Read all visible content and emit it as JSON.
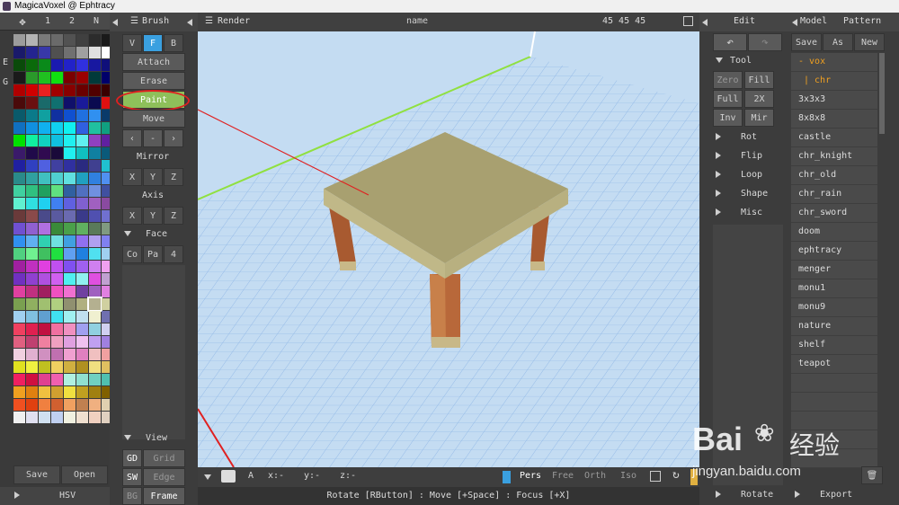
{
  "window": {
    "title": "MagicaVoxel @ Ephtracy"
  },
  "palette_bar": {
    "tabs": [
      "1",
      "2",
      "N"
    ]
  },
  "side_letters": [
    "E",
    "G"
  ],
  "palette_colors": [
    "#9c9c9c",
    "#b4b4b4",
    "#7a7a7a",
    "#6a6a6a",
    "#525252",
    "#404040",
    "#2c2c2c",
    "#1a1a1a",
    "#1a1a6a",
    "#242490",
    "#3838a8",
    "#505050",
    "#707070",
    "#a0a0a0",
    "#e0e0e0",
    "#ffffff",
    "#0a4a0a",
    "#0a6a0a",
    "#0a8a1a",
    "#1a1ab0",
    "#2222c8",
    "#3030e0",
    "#1818a0",
    "#10107a",
    "#1a1a1a",
    "#2a9a2a",
    "#20c020",
    "#10e010",
    "#7a0000",
    "#9a0000",
    "#003a3a",
    "#00006a",
    "#b00000",
    "#d00000",
    "#e82020",
    "#a00000",
    "#880000",
    "#6a0000",
    "#500000",
    "#3a0000",
    "#4a0a0a",
    "#6a1010",
    "#1a6a6a",
    "#107070",
    "#10106a",
    "#1a1a9a",
    "#0a0a50",
    "#e01010",
    "#0a5a6a",
    "#0a7a8a",
    "#10a0a0",
    "#1030a0",
    "#1050d0",
    "#2070e0",
    "#3090f0",
    "#0a3a6a",
    "#1070c0",
    "#1090e0",
    "#10b0f0",
    "#10d0f0",
    "#10f0f0",
    "#3060e0",
    "#20c0a0",
    "#10a080",
    "#00e000",
    "#10f0a0",
    "#10d0c0",
    "#10c0e0",
    "#20f0f0",
    "#60f0f0",
    "#9040c0",
    "#6020a0",
    "#3a1a6a",
    "#200a4a",
    "#300a50",
    "#1a0a3a",
    "#20f0f0",
    "#10c0c0",
    "#1080a0",
    "#0a5a7a",
    "#2020a0",
    "#3040c0",
    "#5060e0",
    "#4040a0",
    "#3030a0",
    "#2a2a80",
    "#404090",
    "#20c0d0",
    "#2a8a8a",
    "#30a0a0",
    "#40c0c0",
    "#50d0d0",
    "#60e0e0",
    "#20a0c0",
    "#3080e0",
    "#5090f0",
    "#40d0a0",
    "#30c080",
    "#20a060",
    "#60e080",
    "#3060a0",
    "#5070c0",
    "#7090e0",
    "#4050a0",
    "#60f0d0",
    "#30e0e0",
    "#20d0f0",
    "#4080f0",
    "#6060e0",
    "#8060d0",
    "#a060c0",
    "#8a4aa0",
    "#6a3a3a",
    "#8a4a4a",
    "#4a4a8a",
    "#5a5aa0",
    "#6a6ab0",
    "#3a3a8a",
    "#5050b0",
    "#7070d0",
    "#7050d0",
    "#9060d0",
    "#b070e0",
    "#3a8a3a",
    "#4aa04a",
    "#60b060",
    "#5a7a5a",
    "#809a80",
    "#3090f0",
    "#60b0f0",
    "#30d0b0",
    "#70e0e0",
    "#40a0e0",
    "#9070f0",
    "#b0a0f0",
    "#8080f0",
    "#50d080",
    "#70f090",
    "#40c060",
    "#20e040",
    "#60a0f0",
    "#2080e0",
    "#50e0f0",
    "#a0d0f0",
    "#a020a0",
    "#c030c0",
    "#e040e0",
    "#c050f0",
    "#8050f0",
    "#a060f0",
    "#d080f0",
    "#f0a0f0",
    "#7030c0",
    "#9040d0",
    "#b050e0",
    "#d060f0",
    "#50f0f0",
    "#90f0f0",
    "#e050e0",
    "#c0a0d0",
    "#e040a0",
    "#c03080",
    "#a02060",
    "#f050c0",
    "#f070d0",
    "#7040a0",
    "#a060c0",
    "#e080e0",
    "#7aa050",
    "#90b060",
    "#a0c070",
    "#b0d080",
    "#909070",
    "#b0b080",
    "#808060",
    "#d0d0a0",
    "#a0d0f0",
    "#80c0e0",
    "#60a0d0",
    "#40e0f0",
    "#a0f0f0",
    "#c0e0f0",
    "#f0f0d0",
    "#7070b0",
    "#f04060",
    "#e02050",
    "#c01040",
    "#f070a0",
    "#f090c0",
    "#a0a0f0",
    "#90d0e0",
    "#d0d0f0",
    "#e06080",
    "#c04070",
    "#f080a0",
    "#f0a0c0",
    "#e0a0e0",
    "#f0c0f0",
    "#c0a0f0",
    "#a080e0",
    "#f0d0e0",
    "#e0b0d0",
    "#d090c0",
    "#c070b0",
    "#f0a0d0",
    "#e080c0",
    "#f0c0c0",
    "#f0a0a0",
    "#e0e020",
    "#f0f040",
    "#c0c020",
    "#f0d060",
    "#d0b040",
    "#b09020",
    "#f0e080",
    "#e0c060",
    "#f02060",
    "#d01040",
    "#e04090",
    "#f060b0",
    "#b0f0e0",
    "#90e0d0",
    "#70d0c0",
    "#50c0b0",
    "#f0a020",
    "#e08010",
    "#f0c040",
    "#d0a030",
    "#f0e040",
    "#c0a020",
    "#a08010",
    "#806000",
    "#f05020",
    "#e04010",
    "#f08040",
    "#d06030",
    "#f0a060",
    "#c08050",
    "#f0b080",
    "#e0d0b0",
    "#f0f0f0",
    "#e0e0f0",
    "#d0e0f0",
    "#c0d0f0",
    "#f0f0e0",
    "#f0e0d0",
    "#f0d0c0",
    "#e0d0c0"
  ],
  "selected_color": "#b4b090",
  "palette_footer": {
    "save": "Save",
    "open": "Open",
    "hsv": "HSV"
  },
  "brush": {
    "title": "Brush",
    "modes": [
      "V",
      "F",
      "B"
    ],
    "active_mode": "F",
    "actions": [
      "Attach",
      "Erase",
      "Paint",
      "Move"
    ],
    "active_action": "Paint",
    "arrows": [
      "‹",
      "-",
      "›"
    ],
    "mirror": "Mirror",
    "axis": "Axis",
    "xyz": [
      "X",
      "Y",
      "Z"
    ],
    "face": "Face",
    "face_opts": [
      "Co",
      "Pa",
      "4"
    ],
    "view": "View",
    "view_rows": [
      [
        "GD",
        "Grid"
      ],
      [
        "SW",
        "Edge"
      ],
      [
        "BG",
        "Frame"
      ]
    ]
  },
  "viewport": {
    "render_label": "Render",
    "name_label": "name",
    "dims": "45  45  45",
    "coord_labels": [
      "A",
      "x:-",
      "y:-",
      "z:-"
    ],
    "projections": [
      "Pers",
      "Free",
      "Orth",
      "Iso"
    ],
    "active_projection": "Pers",
    "status": "Rotate [RButton] : Move [+Space] : Focus [+X]"
  },
  "edit": {
    "title": "Edit",
    "undo": "↶",
    "redo": "↷",
    "tool": "Tool",
    "tool_rows": [
      [
        "Zero",
        "Fill"
      ],
      [
        "Full",
        "2X"
      ],
      [
        "Inv",
        "Mir"
      ]
    ],
    "sections": [
      "Rot",
      "Flip",
      "Loop",
      "Shape",
      "Misc"
    ],
    "bottom": "Rotate"
  },
  "model": {
    "tabs": [
      "Model",
      "Pattern"
    ],
    "buttons": [
      "Save",
      "As",
      "New"
    ],
    "folders": [
      "- vox",
      "| chr"
    ],
    "files": [
      "3x3x3",
      "8x8x8",
      "castle",
      "chr_knight",
      "chr_old",
      "chr_rain",
      "chr_sword",
      "doom",
      "ephtracy",
      "menger",
      "monu1",
      "monu9",
      "nature",
      "shelf",
      "teapot"
    ],
    "export": "Export"
  },
  "watermark": {
    "brand": "Bai",
    "brand2": "经验",
    "url": "jingyan.baidu.com"
  }
}
